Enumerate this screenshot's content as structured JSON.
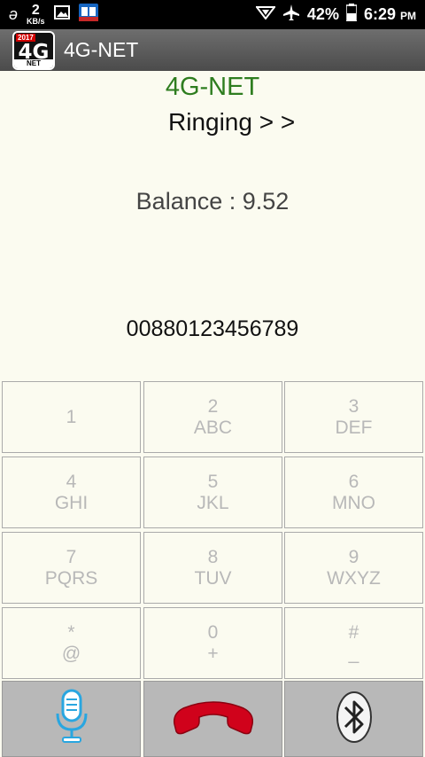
{
  "status_bar": {
    "speed_value": "2",
    "speed_unit": "KB/s",
    "battery": "42%",
    "time": "6:29",
    "ampm": "PM",
    "icons": [
      "alipay-icon",
      "image-icon",
      "book-icon",
      "vpn-icon",
      "airplane-icon",
      "battery-icon"
    ]
  },
  "app_bar": {
    "logo_year": "2017",
    "logo_text": "4G",
    "logo_sub": "NET",
    "title": "4G-NET"
  },
  "call": {
    "network_name": "4G-NET",
    "status": "Ringing > >",
    "balance": "Balance : 9.52",
    "number": "00880123456789"
  },
  "keypad": [
    {
      "digit": "1",
      "letters": ""
    },
    {
      "digit": "2",
      "letters": "ABC"
    },
    {
      "digit": "3",
      "letters": "DEF"
    },
    {
      "digit": "4",
      "letters": "GHI"
    },
    {
      "digit": "5",
      "letters": "JKL"
    },
    {
      "digit": "6",
      "letters": "MNO"
    },
    {
      "digit": "7",
      "letters": "PQRS"
    },
    {
      "digit": "8",
      "letters": "TUV"
    },
    {
      "digit": "9",
      "letters": "WXYZ"
    },
    {
      "digit": "*",
      "letters": "@"
    },
    {
      "digit": "0",
      "letters": "+"
    },
    {
      "digit": "#",
      "letters": "_"
    }
  ],
  "actions": {
    "icons": [
      "microphone-icon",
      "end-call-icon",
      "bluetooth-icon"
    ],
    "colors": {
      "mic": "#29a6e0",
      "end_call": "#d0021b"
    }
  }
}
